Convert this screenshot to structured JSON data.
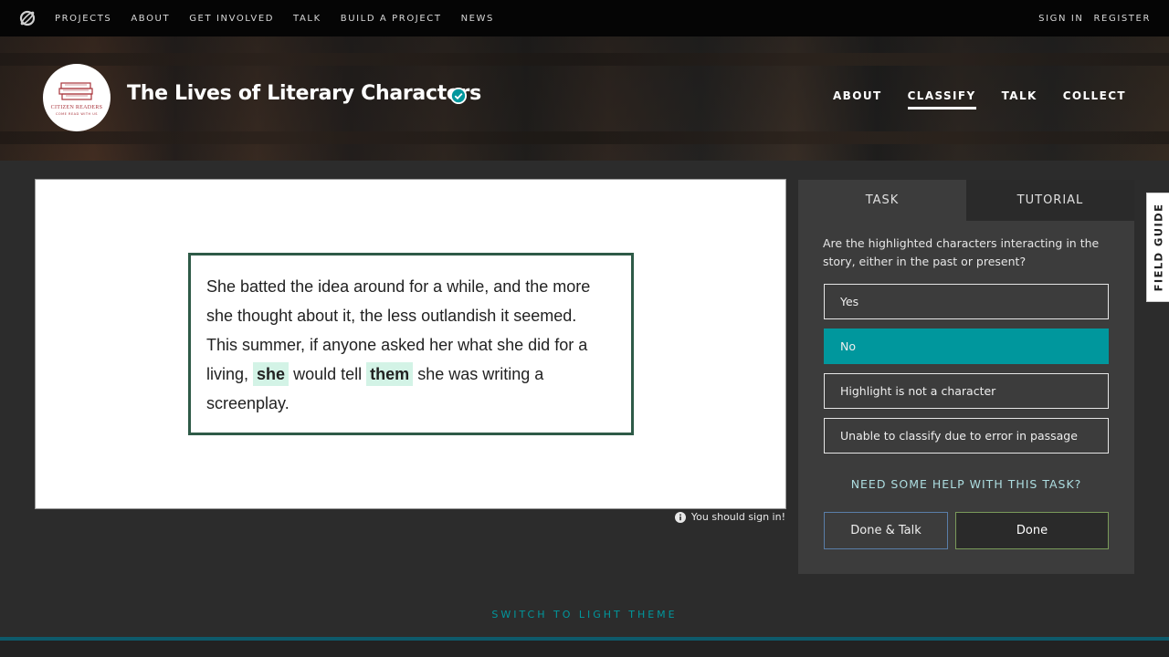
{
  "site_nav": {
    "links": [
      "PROJECTS",
      "ABOUT",
      "GET INVOLVED",
      "TALK",
      "BUILD A PROJECT",
      "NEWS"
    ],
    "sign_in": "SIGN IN",
    "register": "REGISTER"
  },
  "project": {
    "title": "The Lives of Literary Characters",
    "avatar_text_top": "CITIZEN READERS",
    "avatar_text_bottom": "COME READ WITH US",
    "nav": [
      "ABOUT",
      "CLASSIFY",
      "TALK",
      "COLLECT"
    ],
    "active_nav": "CLASSIFY"
  },
  "passage": {
    "line1": "She batted the idea around for a while, and the more",
    "line2": "she thought about it, the less outlandish it seemed.",
    "line3": "This summer, if anyone asked her what she did for a",
    "line4_a": "living,",
    "highlight1": "she",
    "line4_b": "would tell",
    "highlight2": "them",
    "line4_c": "she was writing a",
    "line5": "screenplay."
  },
  "signin_note": "You should sign in!",
  "task_panel": {
    "tab_task": "TASK",
    "tab_tutorial": "TUTORIAL",
    "question": "Are the highlighted characters interacting in the story, either in the past or present?",
    "answers": [
      "Yes",
      "No",
      "Highlight is not a character",
      "Unable to classify due to error in passage"
    ],
    "selected_answer": "No",
    "help": "NEED SOME HELP WITH THIS TASK?",
    "done_talk": "Done & Talk",
    "done": "Done"
  },
  "field_guide": "FIELD GUIDE",
  "footer": {
    "theme_switch": "SWITCH TO LIGHT THEME"
  },
  "colors": {
    "accent": "#00979d",
    "passage_border": "#2e5a47",
    "highlight": "#d3f3e6"
  }
}
